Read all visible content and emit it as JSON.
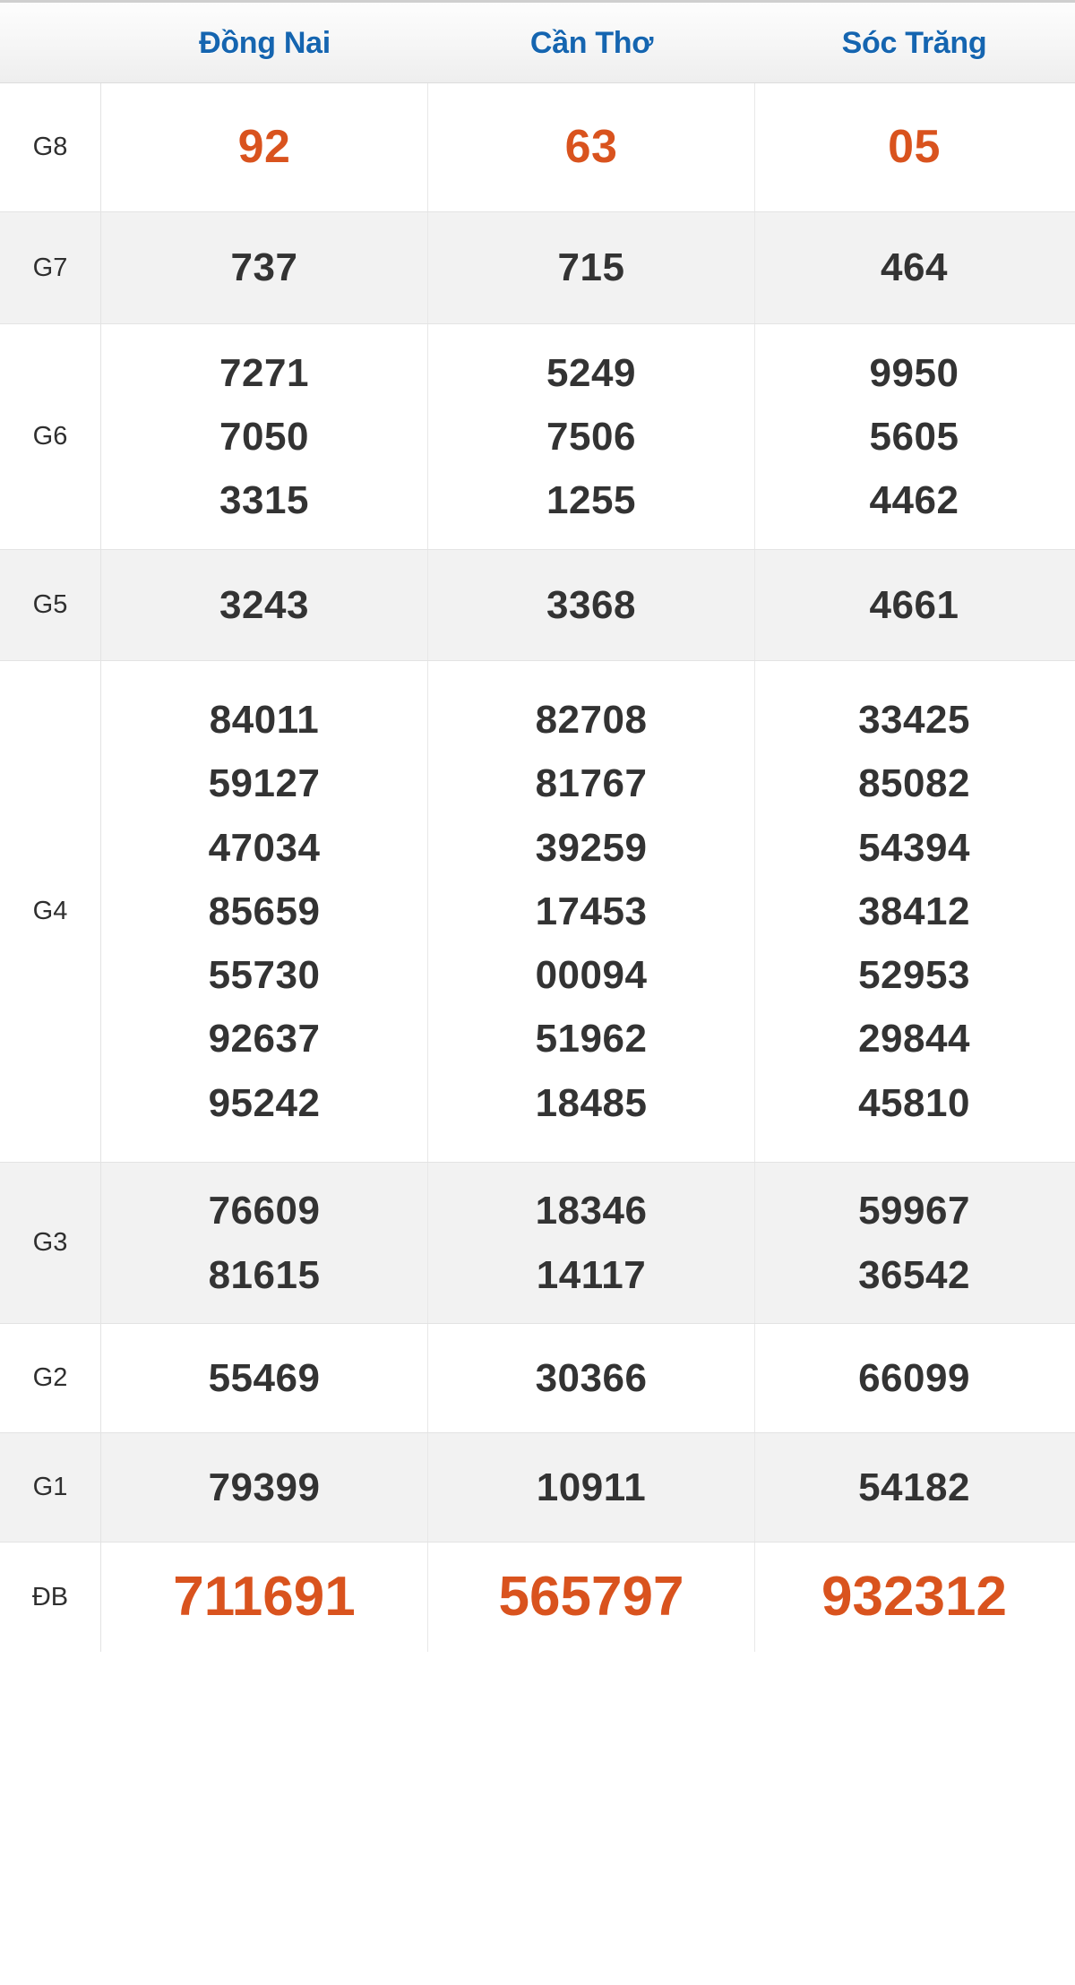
{
  "header": {
    "label_col": "",
    "provinces": [
      "Đồng Nai",
      "Cần Thơ",
      "Sóc Trăng"
    ]
  },
  "colors": {
    "province_blue": "#1565b0",
    "highlight_orange": "#d9531e",
    "number_dark": "#333333",
    "row_alt_bg": "#f2f2f2",
    "row_bg": "#ffffff",
    "border": "#e3e3e3"
  },
  "table": {
    "prize_rows": [
      {
        "label": "G8",
        "highlight": true,
        "cells": [
          [
            "92"
          ],
          [
            "63"
          ],
          [
            "05"
          ]
        ]
      },
      {
        "label": "G7",
        "highlight": false,
        "cells": [
          [
            "737"
          ],
          [
            "715"
          ],
          [
            "464"
          ]
        ]
      },
      {
        "label": "G6",
        "highlight": false,
        "cells": [
          [
            "7271",
            "7050",
            "3315"
          ],
          [
            "5249",
            "7506",
            "1255"
          ],
          [
            "9950",
            "5605",
            "4462"
          ]
        ]
      },
      {
        "label": "G5",
        "highlight": false,
        "cells": [
          [
            "3243"
          ],
          [
            "3368"
          ],
          [
            "4661"
          ]
        ]
      },
      {
        "label": "G4",
        "highlight": false,
        "cells": [
          [
            "84011",
            "59127",
            "47034",
            "85659",
            "55730",
            "92637",
            "95242"
          ],
          [
            "82708",
            "81767",
            "39259",
            "17453",
            "00094",
            "51962",
            "18485"
          ],
          [
            "33425",
            "85082",
            "54394",
            "38412",
            "52953",
            "29844",
            "45810"
          ]
        ]
      },
      {
        "label": "G3",
        "highlight": false,
        "cells": [
          [
            "76609",
            "81615"
          ],
          [
            "18346",
            "14117"
          ],
          [
            "59967",
            "36542"
          ]
        ]
      },
      {
        "label": "G2",
        "highlight": false,
        "cells": [
          [
            "55469"
          ],
          [
            "30366"
          ],
          [
            "66099"
          ]
        ]
      },
      {
        "label": "G1",
        "highlight": false,
        "cells": [
          [
            "79399"
          ],
          [
            "10911"
          ],
          [
            "54182"
          ]
        ]
      },
      {
        "label": "ĐB",
        "highlight": true,
        "cells": [
          [
            "711691"
          ],
          [
            "565797"
          ],
          [
            "932312"
          ]
        ]
      }
    ]
  }
}
